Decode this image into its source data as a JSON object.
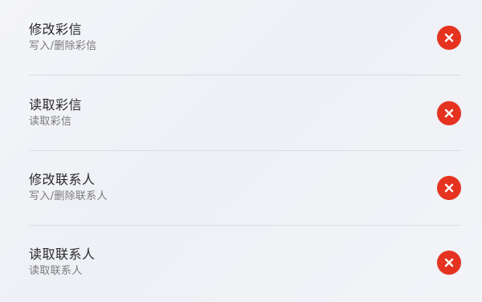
{
  "permissions": [
    {
      "title": "修改彩信",
      "subtitle": "写入/删除彩信",
      "action_icon": "remove-icon"
    },
    {
      "title": "读取彩信",
      "subtitle": "读取彩信",
      "action_icon": "remove-icon"
    },
    {
      "title": "修改联系人",
      "subtitle": "写入/删除联系人",
      "action_icon": "remove-icon"
    },
    {
      "title": "读取联系人",
      "subtitle": "读取联系人",
      "action_icon": "remove-icon"
    }
  ],
  "colors": {
    "remove_button": "#e5331f",
    "title_text": "#2a2a2a",
    "subtitle_text": "#7b7b7b",
    "divider": "#dcdee3"
  }
}
